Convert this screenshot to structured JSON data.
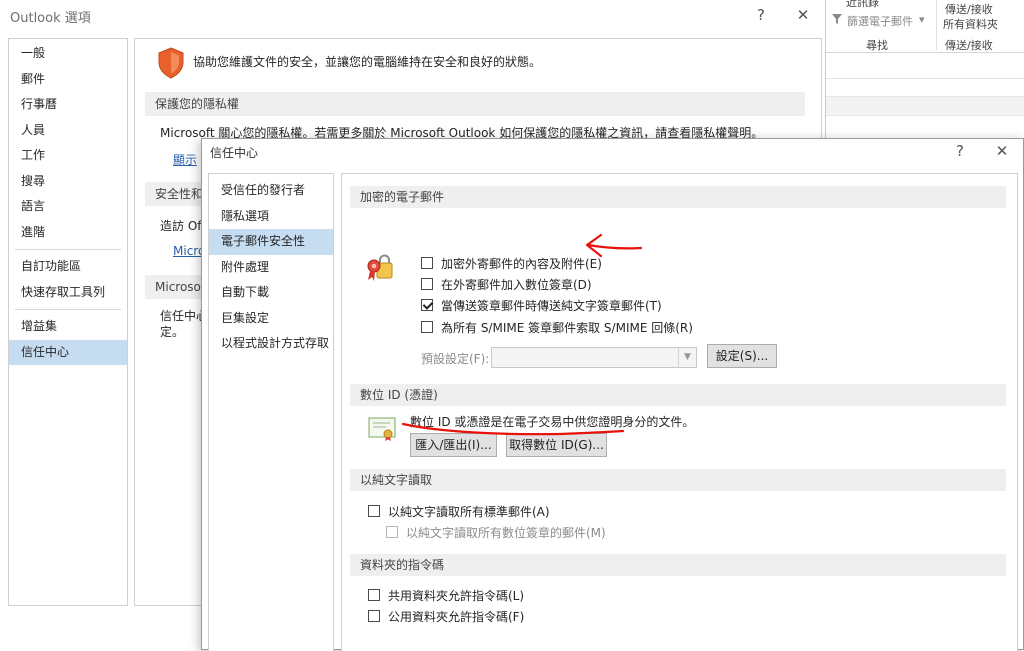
{
  "background_ribbon": {
    "top_left_partial": "近訊錄",
    "filter_mail": "篩選電子郵件",
    "send_receive_all_line1": "傳送/接收",
    "send_receive_all_line2": "所有資料夾",
    "group_find": "尋找",
    "group_send_receive": "傳送/接收"
  },
  "outlook_options": {
    "title": "Outlook 選項",
    "help_glyph": "?",
    "close_glyph": "✕",
    "nav": [
      {
        "label": "一般"
      },
      {
        "label": "郵件"
      },
      {
        "label": "行事曆"
      },
      {
        "label": "人員"
      },
      {
        "label": "工作"
      },
      {
        "label": "搜尋"
      },
      {
        "label": "語言"
      },
      {
        "label": "進階"
      },
      {
        "label": "自訂功能區"
      },
      {
        "label": "快速存取工具列"
      },
      {
        "label": "增益集"
      },
      {
        "label": "信任中心",
        "selected": true
      }
    ],
    "intro": "協助您維護文件的安全，並讓您的電腦維持在安全和良好的狀態。",
    "privacy_header": "保護您的隱私權",
    "privacy_text": "Microsoft 關心您的隱私權。若需更多關於 Microsoft Outlook 如何保護您的隱私權之資訊，請查看隱私權聲明。",
    "privacy_link": "顯示",
    "security_header": "安全性和",
    "security_text": "造訪 Of",
    "security_link": "Micro",
    "ms_header": "Microso",
    "trust_text_line1": "信任中心",
    "trust_text_line2": "定。"
  },
  "trust_center": {
    "title": "信任中心",
    "help_glyph": "?",
    "close_glyph": "✕",
    "nav": [
      {
        "label": "受信任的發行者"
      },
      {
        "label": "隱私選項"
      },
      {
        "label": "電子郵件安全性",
        "selected": true
      },
      {
        "label": "附件處理"
      },
      {
        "label": "自動下載"
      },
      {
        "label": "巨集設定"
      },
      {
        "label": "以程式設計方式存取"
      }
    ],
    "encrypted_header": "加密的電子郵件",
    "encrypt_options": [
      {
        "label": "加密外寄郵件的內容及附件(E)",
        "checked": false
      },
      {
        "label": "在外寄郵件加入數位簽章(D)",
        "checked": false
      },
      {
        "label": "當傳送簽章郵件時傳送純文字簽章郵件(T)",
        "checked": true
      },
      {
        "label": "為所有 S/MIME 簽章郵件索取 S/MIME 回條(R)",
        "checked": false
      }
    ],
    "default_setting_label": "預設設定(F):",
    "default_setting_value": "",
    "settings_button": "設定(S)...",
    "digital_id_header": "數位 ID (憑證)",
    "digital_id_text": "數位 ID 或憑證是在電子交易中供您證明身分的文件。",
    "import_export_button": "匯入/匯出(I)...",
    "get_digital_id_button": "取得數位 ID(G)...",
    "plain_text_header": "以純文字讀取",
    "plain_text_options": [
      {
        "label": "以純文字讀取所有標準郵件(A)",
        "checked": false,
        "disabled": false
      },
      {
        "label": "以純文字讀取所有數位簽章的郵件(M)",
        "checked": false,
        "disabled": true
      }
    ],
    "folder_script_header": "資料夾的指令碼",
    "folder_script_options": [
      {
        "label": "共用資料夾允許指令碼(L)",
        "checked": false
      },
      {
        "label": "公用資料夾允許指令碼(F)",
        "checked": false
      }
    ]
  },
  "annotation_color": "#e8120c"
}
